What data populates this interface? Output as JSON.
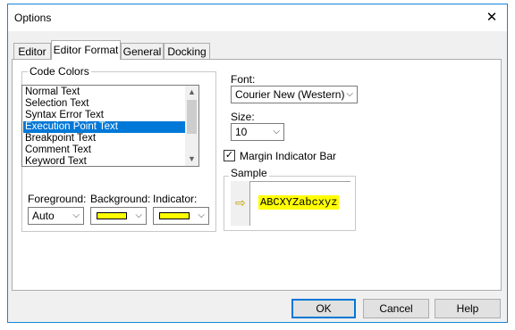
{
  "window": {
    "title": "Options",
    "close_glyph": "✕"
  },
  "tabs": [
    {
      "label": "Editor"
    },
    {
      "label": "Editor Format"
    },
    {
      "label": "General"
    },
    {
      "label": "Docking"
    }
  ],
  "code_colors": {
    "group_label": "Code Colors",
    "items": [
      "Normal Text",
      "Selection Text",
      "Syntax Error Text",
      "Execution Point Text",
      "Breakpoint Text",
      "Comment Text",
      "Keyword Text"
    ],
    "selected": "Execution Point Text",
    "foreground": {
      "label": "Foreground:",
      "value": "Auto"
    },
    "background": {
      "label": "Background:",
      "color": "#ffff00"
    },
    "indicator": {
      "label": "Indicator:",
      "color": "#ffff00"
    }
  },
  "font": {
    "label": "Font:",
    "value": "Courier New (Western)"
  },
  "size": {
    "label": "Size:",
    "value": "10"
  },
  "margin_indicator": {
    "label": "Margin Indicator Bar",
    "checked": true,
    "check_glyph": "✓"
  },
  "sample": {
    "label": "Sample",
    "text": "ABCXYZabcxyz",
    "highlight": "#ffff00",
    "arrow_icon": "⇨"
  },
  "scroll": {
    "up": "▲",
    "down": "▼"
  },
  "dropdown_arrow": "⌵",
  "buttons": {
    "ok": "OK",
    "cancel": "Cancel",
    "help": "Help"
  },
  "colors": {
    "accent": "#0078d7",
    "border": "#1883d7"
  }
}
